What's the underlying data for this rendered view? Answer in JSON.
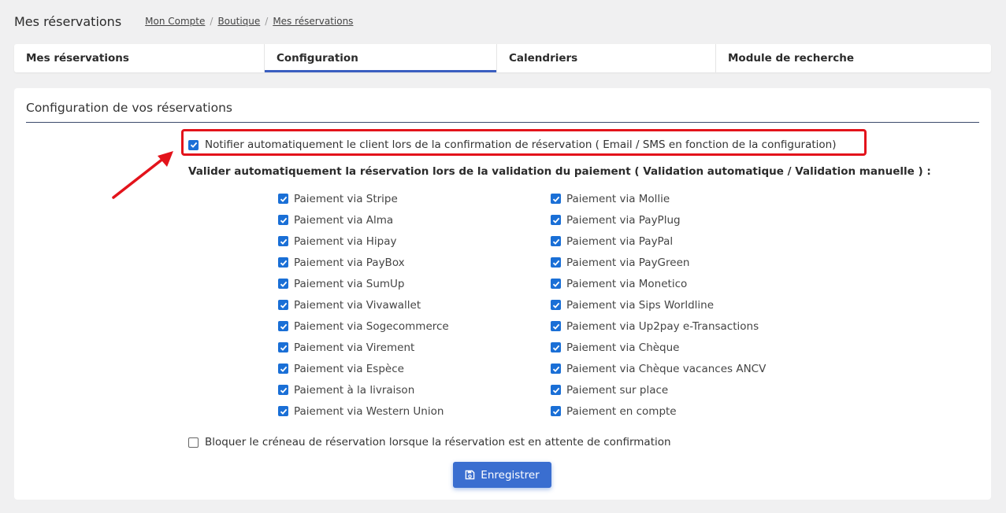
{
  "header": {
    "title": "Mes réservations",
    "breadcrumb": [
      "Mon Compte",
      "Boutique",
      "Mes réservations"
    ]
  },
  "tabs": [
    {
      "label": "Mes réservations",
      "active": false
    },
    {
      "label": "Configuration",
      "active": true
    },
    {
      "label": "Calendriers",
      "active": false
    },
    {
      "label": "Module de recherche",
      "active": false
    }
  ],
  "card": {
    "title": "Configuration de vos réservations",
    "notify": {
      "label": "Notifier automatiquement le client lors de la confirmation de réservation ( Email / SMS en fonction de la configuration)",
      "checked": true
    },
    "validate_label": "Valider automatiquement la réservation lors de la validation du paiement ( Validation automatique / Validation manuelle ) :",
    "payments_left": [
      "Paiement via Stripe",
      "Paiement via Alma",
      "Paiement via Hipay",
      "Paiement via PayBox",
      "Paiement via SumUp",
      "Paiement via Vivawallet",
      "Paiement via Sogecommerce",
      "Paiement via Virement",
      "Paiement via Espèce",
      "Paiement à la livraison",
      "Paiement via Western Union"
    ],
    "payments_right": [
      "Paiement via Mollie",
      "Paiement via PayPlug",
      "Paiement via PayPal",
      "Paiement via PayGreen",
      "Paiement via Monetico",
      "Paiement via Sips Worldline",
      "Paiement via Up2pay e-Transactions",
      "Paiement via Chèque",
      "Paiement via Chèque vacances ANCV",
      "Paiement sur place",
      "Paiement en compte"
    ],
    "block": {
      "label": "Bloquer le créneau de réservation lorsque la réservation est en attente de confirmation",
      "checked": false
    },
    "save_label": "Enregistrer"
  },
  "colors": {
    "accent": "#3a6ed0",
    "tab_indicator": "#3a5ec0",
    "highlight": "#e3131b",
    "checkbox": "#1a6fd6"
  },
  "icons": {
    "save": "floppy-disk-icon",
    "annotation": "red-arrow"
  }
}
